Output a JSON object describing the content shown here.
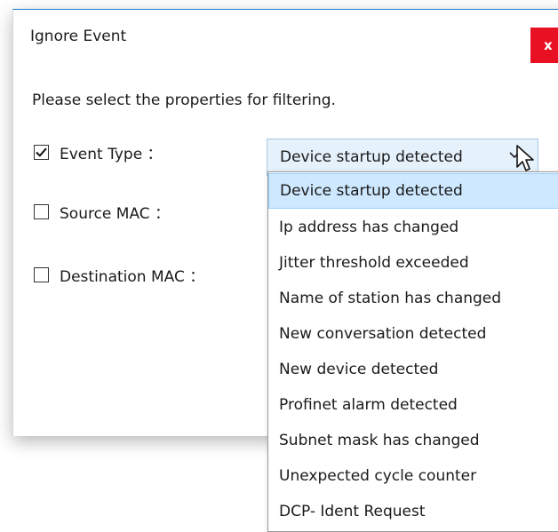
{
  "dialog": {
    "title": "Ignore Event",
    "close_label": "x",
    "instruction": "Please select the properties for filtering.",
    "filters": [
      {
        "label": "Event Type ：",
        "checked": true
      },
      {
        "label": "Source MAC ：",
        "checked": false
      },
      {
        "label": "Destination MAC ：",
        "checked": false
      }
    ],
    "event_type_combo": {
      "selected": "Device startup detected",
      "options": [
        "Device startup detected",
        "Ip address has changed",
        "Jitter threshold exceeded",
        "Name of station has changed",
        "New conversation detected",
        "New device detected",
        "Profinet alarm detected",
        "Subnet mask has changed",
        "Unexpected cycle counter",
        "DCP- Ident Request"
      ],
      "highlighted_index": 0
    }
  },
  "colors": {
    "close_button": "#e81123",
    "title_border": "#1e78d2",
    "combo_bg": "#e5f1fb",
    "highlight_bg": "#cde8ff"
  },
  "icons": {
    "checkmark": "checkmark-icon",
    "dropdown": "chevron-down-icon",
    "cursor": "mouse-pointer-icon"
  }
}
